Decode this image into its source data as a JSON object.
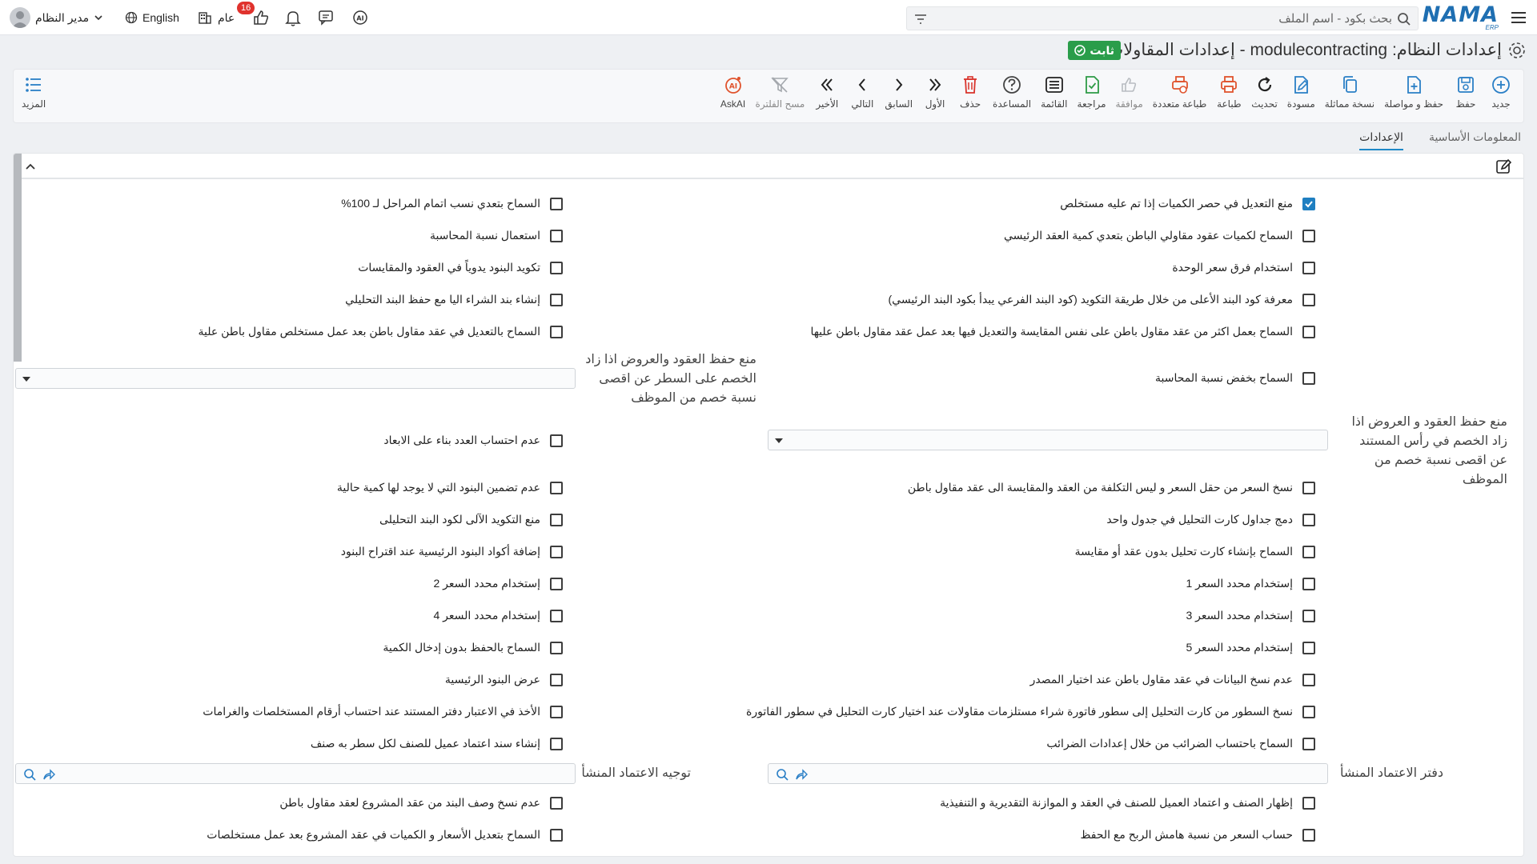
{
  "topbar": {
    "search_placeholder": "بحث بكود - اسم الملف",
    "user_label": "مدير النظام",
    "lang_label": "English",
    "general_label": "عام",
    "notif_count": "16",
    "logo_text": "NAMA",
    "logo_sub": "ERP"
  },
  "title": {
    "text": "إعدادات النظام: modulecontracting - إعدادات المقاولات",
    "status": "ثابت"
  },
  "toolbar": {
    "new": "جديد",
    "save": "حفظ",
    "save_continue": "حفظ و مواصلة",
    "duplicate": "نسخة مماثلة",
    "draft": "مسودة",
    "refresh": "تحديث",
    "print": "طباعة",
    "multi_print": "طباعة متعددة",
    "approve": "موافقة",
    "review": "مراجعة",
    "list": "القائمة",
    "help": "المساعدة",
    "delete": "حذف",
    "first": "الأول",
    "previous": "السابق",
    "next": "التالي",
    "last": "الأخير",
    "clear_filter": "مسح الفلترة",
    "askai": "AskAI",
    "more": "المزيد"
  },
  "tabs": {
    "basic": "المعلومات الأساسية",
    "settings": "الإعدادات"
  },
  "right_col": [
    {
      "label": "منع التعديل في حصر الكميات إذا تم عليه مستخلص",
      "checked": true
    },
    {
      "label": "السماح لكميات عقود مقاولي الباطن بتعدي كمية العقد الرئيسي",
      "checked": false
    },
    {
      "label": "استخدام فرق سعر الوحدة",
      "checked": false
    },
    {
      "label": "معرفة كود البند الأعلى من خلال طريقة التكويد (كود البند الفرعي يبدأ بكود البند الرئيسي)",
      "checked": false
    },
    {
      "label": "السماح بعمل اكثر من عقد مقاول باطن على نفس المقايسة والتعديل فيها بعد عمل عقد مقاول باطن عليها",
      "checked": false
    },
    {
      "label": "السماح بخفض نسبة المحاسبة",
      "checked": false
    }
  ],
  "left_col": [
    {
      "label": "السماح بتعدي نسب اتمام المراحل لـ 100%",
      "checked": false
    },
    {
      "label": "استعمال نسبة المحاسبة",
      "checked": false
    },
    {
      "label": "تكويد البنود يدوياً في العقود والمقايسات",
      "checked": false
    },
    {
      "label": "إنشاء بند الشراء اليا مع حفظ البند التحليلي",
      "checked": false
    },
    {
      "label": "السماح بالتعديل في عقد مقاول باطن بعد عمل مستخلص مقاول باطن علية",
      "checked": false
    }
  ],
  "fields": {
    "line_discount_label": "منع حفظ العقود والعروض اذا زاد الخصم على السطر عن اقصى نسبة خصم من الموظف",
    "header_discount_label": "منع حفظ العقود و العروض اذا زاد الخصم في رأس المستند عن اقصى نسبة خصم من الموظف",
    "no_count_dims": "عدم احتساب العدد بناء على الابعاد",
    "approval_book_label": "دفتر الاعتماد المنشأ",
    "approval_route_label": "توجيه الاعتماد المنشأ"
  },
  "right_col2": [
    {
      "label": "نسخ السعر من حقل السعر و ليس التكلفة من العقد والمقايسة الى عقد مقاول باطن",
      "checked": false
    },
    {
      "label": "دمج جداول كارت التحليل في جدول واحد",
      "checked": false
    },
    {
      "label": "السماح بإنشاء كارت تحليل بدون عقد أو مقايسة",
      "checked": false
    },
    {
      "label": "إستخدام محدد السعر 1",
      "checked": false
    },
    {
      "label": "إستخدام محدد السعر 3",
      "checked": false
    },
    {
      "label": "إستخدام محدد السعر 5",
      "checked": false
    },
    {
      "label": "عدم نسخ البيانات في عقد مقاول باطن عند اختيار المصدر",
      "checked": false
    },
    {
      "label": "نسخ السطور من كارت التحليل إلى سطور فاتورة شراء مستلزمات مقاولات عند اختيار كارت التحليل في سطور الفاتورة",
      "checked": false
    },
    {
      "label": "السماح باحتساب الضرائب من خلال إعدادات الضرائب",
      "checked": false
    }
  ],
  "left_col2": [
    {
      "label": "عدم تضمين البنود التي لا يوجد لها كمية حالية",
      "checked": false
    },
    {
      "label": "منع التكويد الآلى لكود البند التحليلى",
      "checked": false
    },
    {
      "label": "إضافة أكواد البنود الرئيسية عند اقتراح البنود",
      "checked": false
    },
    {
      "label": "إستخدام محدد السعر 2",
      "checked": false
    },
    {
      "label": "إستخدام محدد السعر 4",
      "checked": false
    },
    {
      "label": "السماح بالحفظ بدون إدخال الكمية",
      "checked": false
    },
    {
      "label": "عرض البنود الرئيسية",
      "checked": false
    },
    {
      "label": "الأخذ في الاعتبار دفتر المستند عند احتساب أرقام المستخلصات والغرامات",
      "checked": false
    },
    {
      "label": "إنشاء سند اعتماد عميل للصنف لكل سطر به صنف",
      "checked": false
    }
  ],
  "right_col3": [
    {
      "label": "إظهار الصنف و اعتماد العميل للصنف في العقد و الموازنة التقديرية و التنفيذية",
      "checked": false
    },
    {
      "label": "حساب السعر من نسبة هامش الربح مع الحفظ",
      "checked": false
    }
  ],
  "left_col3": [
    {
      "label": "عدم نسخ وصف البند من عقد المشروع لعقد مقاول باطن",
      "checked": false
    },
    {
      "label": "السماح بتعديل الأسعار و الكميات في عقد المشروع بعد عمل مستخلصات",
      "checked": false
    }
  ]
}
